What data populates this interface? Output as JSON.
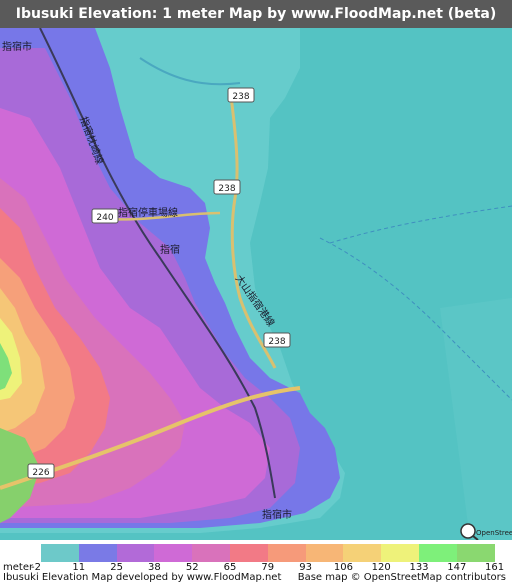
{
  "title": "Ibusuki Elevation: 1 meter Map by www.FloodMap.net (beta)",
  "map": {
    "place_labels": [
      "指宿市",
      "指宿",
      "指宿停車場線",
      "指宿枕崎線",
      "大山指宿港線",
      "指宿市"
    ],
    "route_shields": [
      "238",
      "238",
      "240",
      "238",
      "226"
    ],
    "attribution_watermark": "OpenStreetMap"
  },
  "legend": {
    "unit_label": "meter",
    "values": [
      "-2",
      "11",
      "25",
      "38",
      "52",
      "65",
      "79",
      "93",
      "106",
      "120",
      "133",
      "147",
      "161"
    ],
    "colors": [
      "#6dc9c9",
      "#7a7ae6",
      "#b26ad8",
      "#cf6ad6",
      "#d972bb",
      "#f27a86",
      "#f69a7a",
      "#f7b676",
      "#f5d177",
      "#eef27a",
      "#7ef07a",
      "#8ad870"
    ]
  },
  "footer": {
    "left": "Ibusuki Elevation Map developed by www.FloodMap.net",
    "right": "Base map © OpenStreetMap contributors"
  }
}
